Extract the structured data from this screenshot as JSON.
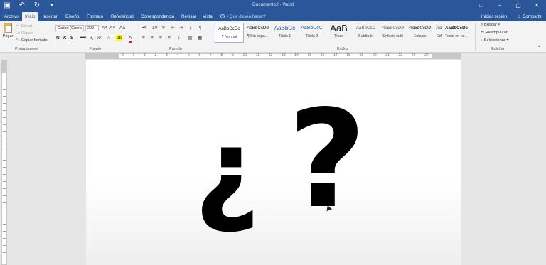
{
  "window": {
    "title": "Documento2 - Word",
    "qat": [
      "save-icon",
      "undo-icon",
      "redo-icon"
    ],
    "controls": [
      "minimize-icon",
      "maximize-icon",
      "close-icon"
    ]
  },
  "tabs": [
    {
      "label": "Archivo"
    },
    {
      "label": "Inicio",
      "active": true
    },
    {
      "label": "Insertar"
    },
    {
      "label": "Diseño"
    },
    {
      "label": "Formato"
    },
    {
      "label": "Referencias"
    },
    {
      "label": "Correspondencia"
    },
    {
      "label": "Revisar"
    },
    {
      "label": "Vista"
    }
  ],
  "tell_me": "¿Qué desea hacer?",
  "signin": "Iniciar sesión",
  "share": "Compartir",
  "ribbon": {
    "clipboard": {
      "paste": "Pegar",
      "cut": "Cortar",
      "copy": "Copiar",
      "format_painter": "Copiar formato",
      "label": "Portapapeles"
    },
    "font": {
      "name": "Calibri (Cuerp",
      "size": "290",
      "label": "Fuente",
      "buttons": [
        "A˄",
        "A˅",
        "Aa",
        "N",
        "K",
        "S",
        "abc",
        "x₂",
        "x²",
        "A",
        "ab",
        "A"
      ]
    },
    "paragraph": {
      "label": "Párrafo",
      "buttons": [
        "•≡",
        "1≡",
        "≡",
        "⇤",
        "⇥",
        "↕",
        "¶",
        "≡",
        "≡",
        "≡",
        "≡",
        "↕",
        "▧",
        "▦"
      ]
    },
    "styles": {
      "label": "Estilos",
      "items": [
        {
          "sample": "AaBbCcDd",
          "name": "¶ Normal",
          "selected": true
        },
        {
          "sample": "AaBbCcDd",
          "name": "¶ Sin espa..."
        },
        {
          "sample": "AaBbCc",
          "name": "Título 1"
        },
        {
          "sample": "AaBbCcC",
          "name": "Título 2"
        },
        {
          "sample": "AaB",
          "name": "Título"
        },
        {
          "sample": "AaBbCcD",
          "name": "Subtítulo"
        },
        {
          "sample": "AaBbCcDd",
          "name": "Énfasis sutil"
        },
        {
          "sample": "AaBbCcDd",
          "name": "Énfasis"
        },
        {
          "sample": "AaBbCcDd",
          "name": "Énfasis int..."
        },
        {
          "sample": "AaBbCcDc",
          "name": "Texto en ne..."
        }
      ]
    },
    "editing": {
      "label": "Edición",
      "find": "Buscar",
      "replace": "Reemplazar",
      "select": "Seleccionar"
    }
  },
  "ruler": {
    "numbers": [
      "2",
      "1",
      "1",
      "2",
      "3",
      "4",
      "5",
      "6",
      "7",
      "8",
      "9",
      "10",
      "11",
      "12",
      "13",
      "14",
      "15",
      "16",
      "17",
      "18",
      "19",
      "20",
      "21",
      "22",
      "24",
      "25"
    ]
  },
  "document": {
    "glyph_inverted": "¿",
    "glyph_question": "?"
  }
}
